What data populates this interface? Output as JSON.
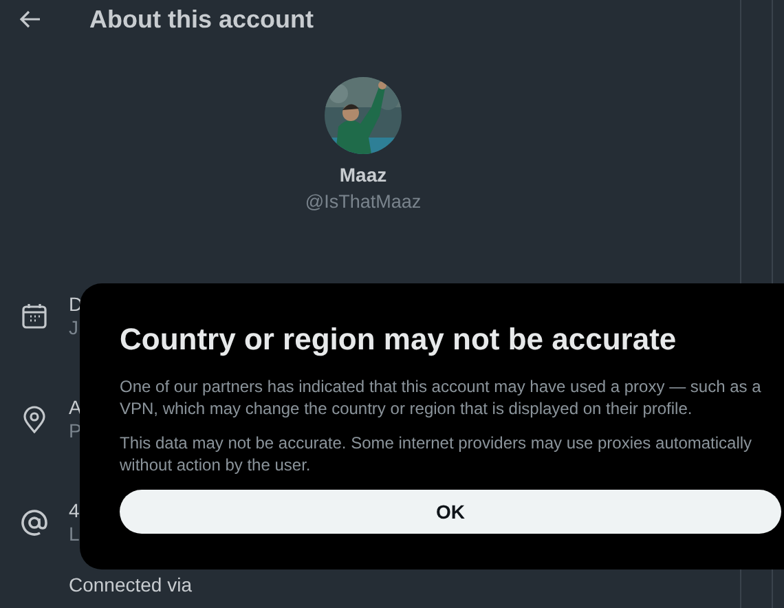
{
  "header": {
    "title": "About this account"
  },
  "profile": {
    "name": "Maaz",
    "handle": "@IsThatMaaz"
  },
  "rows": [
    {
      "label": "D",
      "value": "J"
    },
    {
      "label": "A",
      "value": "P"
    },
    {
      "label": "4",
      "value": "L"
    },
    {
      "label": "Connected via"
    }
  ],
  "dialog": {
    "title": "Country or region may not be accurate",
    "paragraphs": [
      "One of our partners has indicated that this account may have used a proxy — such as a VPN, which may change the country or region that is displayed on their profile.",
      "This data may not be accurate. Some internet providers may use proxies automatically without action by the user."
    ],
    "button": "OK"
  }
}
